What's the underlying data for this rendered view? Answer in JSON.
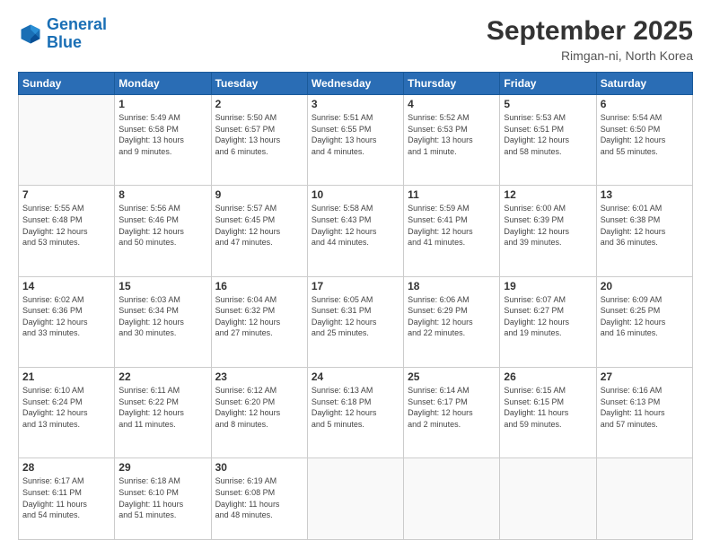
{
  "header": {
    "logo_line1": "General",
    "logo_line2": "Blue",
    "month": "September 2025",
    "location": "Rimgan-ni, North Korea"
  },
  "weekdays": [
    "Sunday",
    "Monday",
    "Tuesday",
    "Wednesday",
    "Thursday",
    "Friday",
    "Saturday"
  ],
  "weeks": [
    [
      {
        "day": "",
        "info": ""
      },
      {
        "day": "1",
        "info": "Sunrise: 5:49 AM\nSunset: 6:58 PM\nDaylight: 13 hours\nand 9 minutes."
      },
      {
        "day": "2",
        "info": "Sunrise: 5:50 AM\nSunset: 6:57 PM\nDaylight: 13 hours\nand 6 minutes."
      },
      {
        "day": "3",
        "info": "Sunrise: 5:51 AM\nSunset: 6:55 PM\nDaylight: 13 hours\nand 4 minutes."
      },
      {
        "day": "4",
        "info": "Sunrise: 5:52 AM\nSunset: 6:53 PM\nDaylight: 13 hours\nand 1 minute."
      },
      {
        "day": "5",
        "info": "Sunrise: 5:53 AM\nSunset: 6:51 PM\nDaylight: 12 hours\nand 58 minutes."
      },
      {
        "day": "6",
        "info": "Sunrise: 5:54 AM\nSunset: 6:50 PM\nDaylight: 12 hours\nand 55 minutes."
      }
    ],
    [
      {
        "day": "7",
        "info": "Sunrise: 5:55 AM\nSunset: 6:48 PM\nDaylight: 12 hours\nand 53 minutes."
      },
      {
        "day": "8",
        "info": "Sunrise: 5:56 AM\nSunset: 6:46 PM\nDaylight: 12 hours\nand 50 minutes."
      },
      {
        "day": "9",
        "info": "Sunrise: 5:57 AM\nSunset: 6:45 PM\nDaylight: 12 hours\nand 47 minutes."
      },
      {
        "day": "10",
        "info": "Sunrise: 5:58 AM\nSunset: 6:43 PM\nDaylight: 12 hours\nand 44 minutes."
      },
      {
        "day": "11",
        "info": "Sunrise: 5:59 AM\nSunset: 6:41 PM\nDaylight: 12 hours\nand 41 minutes."
      },
      {
        "day": "12",
        "info": "Sunrise: 6:00 AM\nSunset: 6:39 PM\nDaylight: 12 hours\nand 39 minutes."
      },
      {
        "day": "13",
        "info": "Sunrise: 6:01 AM\nSunset: 6:38 PM\nDaylight: 12 hours\nand 36 minutes."
      }
    ],
    [
      {
        "day": "14",
        "info": "Sunrise: 6:02 AM\nSunset: 6:36 PM\nDaylight: 12 hours\nand 33 minutes."
      },
      {
        "day": "15",
        "info": "Sunrise: 6:03 AM\nSunset: 6:34 PM\nDaylight: 12 hours\nand 30 minutes."
      },
      {
        "day": "16",
        "info": "Sunrise: 6:04 AM\nSunset: 6:32 PM\nDaylight: 12 hours\nand 27 minutes."
      },
      {
        "day": "17",
        "info": "Sunrise: 6:05 AM\nSunset: 6:31 PM\nDaylight: 12 hours\nand 25 minutes."
      },
      {
        "day": "18",
        "info": "Sunrise: 6:06 AM\nSunset: 6:29 PM\nDaylight: 12 hours\nand 22 minutes."
      },
      {
        "day": "19",
        "info": "Sunrise: 6:07 AM\nSunset: 6:27 PM\nDaylight: 12 hours\nand 19 minutes."
      },
      {
        "day": "20",
        "info": "Sunrise: 6:09 AM\nSunset: 6:25 PM\nDaylight: 12 hours\nand 16 minutes."
      }
    ],
    [
      {
        "day": "21",
        "info": "Sunrise: 6:10 AM\nSunset: 6:24 PM\nDaylight: 12 hours\nand 13 minutes."
      },
      {
        "day": "22",
        "info": "Sunrise: 6:11 AM\nSunset: 6:22 PM\nDaylight: 12 hours\nand 11 minutes."
      },
      {
        "day": "23",
        "info": "Sunrise: 6:12 AM\nSunset: 6:20 PM\nDaylight: 12 hours\nand 8 minutes."
      },
      {
        "day": "24",
        "info": "Sunrise: 6:13 AM\nSunset: 6:18 PM\nDaylight: 12 hours\nand 5 minutes."
      },
      {
        "day": "25",
        "info": "Sunrise: 6:14 AM\nSunset: 6:17 PM\nDaylight: 12 hours\nand 2 minutes."
      },
      {
        "day": "26",
        "info": "Sunrise: 6:15 AM\nSunset: 6:15 PM\nDaylight: 11 hours\nand 59 minutes."
      },
      {
        "day": "27",
        "info": "Sunrise: 6:16 AM\nSunset: 6:13 PM\nDaylight: 11 hours\nand 57 minutes."
      }
    ],
    [
      {
        "day": "28",
        "info": "Sunrise: 6:17 AM\nSunset: 6:11 PM\nDaylight: 11 hours\nand 54 minutes."
      },
      {
        "day": "29",
        "info": "Sunrise: 6:18 AM\nSunset: 6:10 PM\nDaylight: 11 hours\nand 51 minutes."
      },
      {
        "day": "30",
        "info": "Sunrise: 6:19 AM\nSunset: 6:08 PM\nDaylight: 11 hours\nand 48 minutes."
      },
      {
        "day": "",
        "info": ""
      },
      {
        "day": "",
        "info": ""
      },
      {
        "day": "",
        "info": ""
      },
      {
        "day": "",
        "info": ""
      }
    ]
  ]
}
